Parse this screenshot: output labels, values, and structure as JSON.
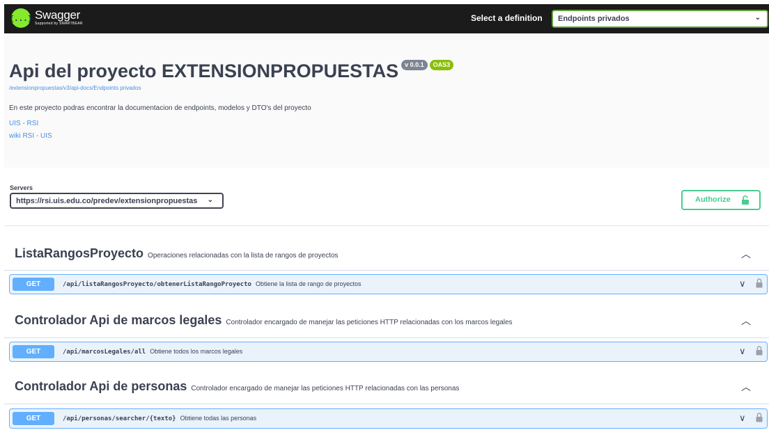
{
  "topbar": {
    "logo_name": "Swagger",
    "logo_sub": "Supported by SMARTBEAR",
    "logo_glyph": "{...}",
    "definition_label": "Select a definition",
    "definition_value": "Endpoints privados",
    "chevron": "⌄"
  },
  "info": {
    "title": "Api del proyecto EXTENSIONPROPUESTAS",
    "version_badge": "v 0.0.1",
    "oas_badge": "OAS3",
    "url": "/extensionpropuestas/v3/api-docs/Endpoints privados",
    "description": "En este proyecto podras encontrar la documentacion de endpoints, modelos y DTO's del proyecto",
    "link1": "UIS - RSI",
    "link2": "wiki RSI - UIS"
  },
  "servers": {
    "label": "Servers",
    "value": "https://rsi.uis.edu.co/predev/extensionpropuestas",
    "chevron": "⌄"
  },
  "authorize": {
    "label": "Authorize"
  },
  "tags": [
    {
      "name": "ListaRangosProyecto",
      "description": "Operaciones relacionadas con la lista de rangos de proyectos",
      "chevron": "︿",
      "op": {
        "method": "GET",
        "path": "/api/listaRangosProyecto/obtenerListaRangoProyecto",
        "summary": "Obtiene la lista de rango de proyectos",
        "chevron": "∨"
      }
    },
    {
      "name": "Controlador Api de marcos legales",
      "description": "Controlador encargado de manejar las peticiones HTTP relacionadas con los marcos legales",
      "chevron": "︿",
      "op": {
        "method": "GET",
        "path": "/api/marcosLegales/all",
        "summary": "Obtiene todos los marcos legales",
        "chevron": "∨"
      }
    },
    {
      "name": "Controlador Api de personas",
      "description": "Controlador encargado de manejar las peticiones HTTP relacionadas con las personas",
      "chevron": "︿",
      "op": {
        "method": "GET",
        "path": "/api/personas/searcher/{texto}",
        "summary": "Obtiene todas las personas",
        "chevron": "∨"
      }
    }
  ],
  "colors": {
    "topbar": "#1b1b1b",
    "accent_green": "#49cc90",
    "get_blue": "#61affe",
    "get_bg": "#eaf3fc",
    "link": "#4990e2"
  }
}
